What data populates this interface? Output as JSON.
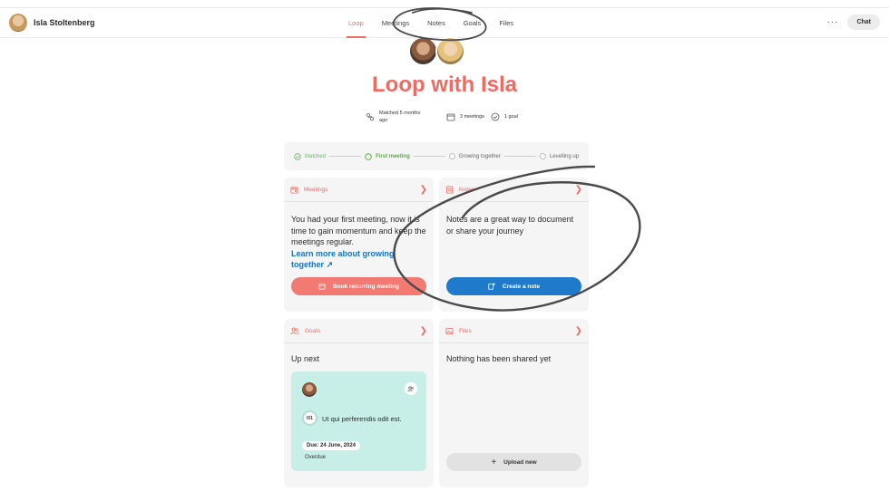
{
  "header": {
    "user_name": "Isla Stoltenberg",
    "tabs": [
      "Loop",
      "Meetings",
      "Notes",
      "Goals",
      "Files"
    ],
    "active_tab": "Loop",
    "more_label": "···",
    "chat_label": "Chat"
  },
  "page": {
    "title": "Loop with Isla",
    "meta": {
      "matched": "Matched 5 months ago",
      "meetings": "3 meetings",
      "goals": "1 goal"
    }
  },
  "stepper": {
    "steps": [
      {
        "label": "Matched",
        "state": "done"
      },
      {
        "label": "First meeting",
        "state": "current"
      },
      {
        "label": "Growing together",
        "state": "future"
      },
      {
        "label": "Levelling up",
        "state": "future"
      }
    ]
  },
  "cards": {
    "meetings": {
      "title": "Meetings",
      "body": "You had your first meeting, now it is time to gain momentum and keep the meetings regular.",
      "link": "Learn more about growing together ↗",
      "button": "Book recurring meeting"
    },
    "notes": {
      "title": "Notes",
      "body": "Notes are a great way to document or share your journey",
      "button": "Create a note"
    },
    "goals": {
      "title": "Goals",
      "subtitle": "Up next",
      "goal": {
        "progress": "0/1",
        "text": "Ut qui perferendis odit est.",
        "due": "Due: 24 June, 2024",
        "status": "Overdue"
      }
    },
    "files": {
      "title": "Files",
      "body": "Nothing has been shared yet",
      "button": "Upload new"
    }
  },
  "colors": {
    "accent": "#f06a62",
    "primary_blue": "#1f7acb",
    "success_green": "#58b13d",
    "goal_tile": "#c8efe7",
    "annotation_stroke": "#3a3a3a"
  }
}
